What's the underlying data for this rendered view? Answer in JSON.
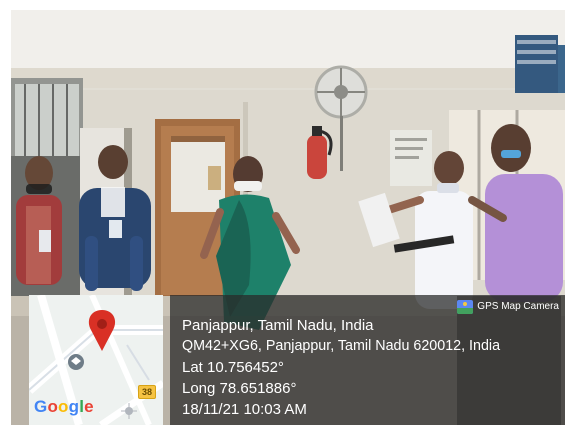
{
  "location": {
    "title": "Panjappur, Tamil Nadu, India",
    "address": "QM42+XG6, Panjappur, Tamil Nadu 620012, India",
    "latitude": "Lat 10.756452°",
    "longitude": "Long 78.651886°",
    "timestamp": "18/11/21 10:03 AM"
  },
  "gps_camera_badge": {
    "label": "GPS Map Camera",
    "icon": "gps-map-camera-icon"
  },
  "map": {
    "logo_text": "Google",
    "route_badge": "38",
    "pin_icon": "map-pin-icon",
    "marker_icon": "education-marker-icon",
    "compass_icon": "compass-icon",
    "pin_color": "#d93025"
  },
  "colors": {
    "overlay_panel": "#2a2a2a",
    "text": "#ffffff",
    "wall": "#ddd9cf",
    "door": "#a66a3a"
  }
}
